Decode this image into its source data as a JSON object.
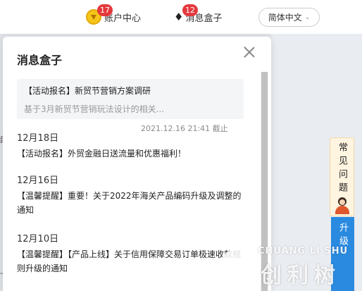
{
  "header": {
    "account": {
      "label": "账户中心",
      "badge": "17"
    },
    "messages": {
      "label": "消息盒子",
      "badge": "12"
    },
    "language": {
      "selected": "简体中文"
    }
  },
  "background": {
    "edge_chars": [
      "助",
      "上"
    ]
  },
  "message_box": {
    "title": "消息盒子",
    "featured": {
      "title": "【活动报名】新贸节营销方案调研",
      "description": "基于3月新贸节营销玩法设计的相关...",
      "deadline": "2021.12.16 21:41 截止"
    },
    "messages": [
      {
        "date": "12月18日",
        "text": "【活动报名】外贸金融日送流量和优惠福利！"
      },
      {
        "date": "12月16日",
        "text": "【温馨提醒】重要！关于2022年海关产品编码升级及调整的通知"
      },
      {
        "date": "12月10日",
        "text": "【温馨提醒】【产品上线】关于信用保障交易订单极速收款规则升级的通知"
      }
    ]
  },
  "side_widgets": {
    "faq": "常见问题",
    "upgrade": "升级"
  },
  "watermark": {
    "latin": "CHUANG LI SHU",
    "cjk": "创利树"
  }
}
